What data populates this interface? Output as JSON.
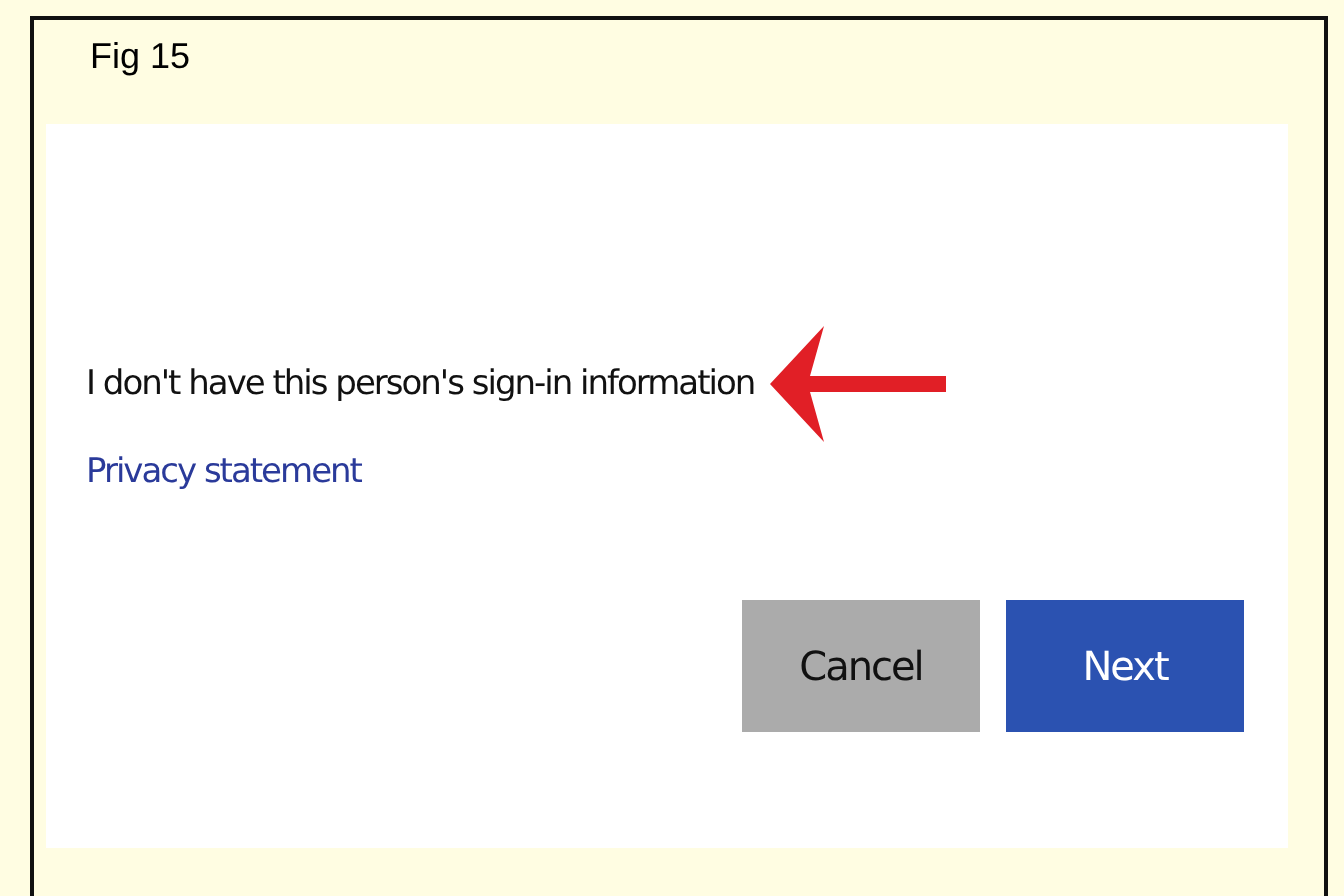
{
  "figure": {
    "caption": "Fig 15"
  },
  "dialog": {
    "option_text": "I don't have this person's sign-in information",
    "privacy_link": "Privacy statement",
    "buttons": [
      {
        "label": "Cancel",
        "kind": "secondary"
      },
      {
        "label": "Next",
        "kind": "primary"
      }
    ]
  }
}
